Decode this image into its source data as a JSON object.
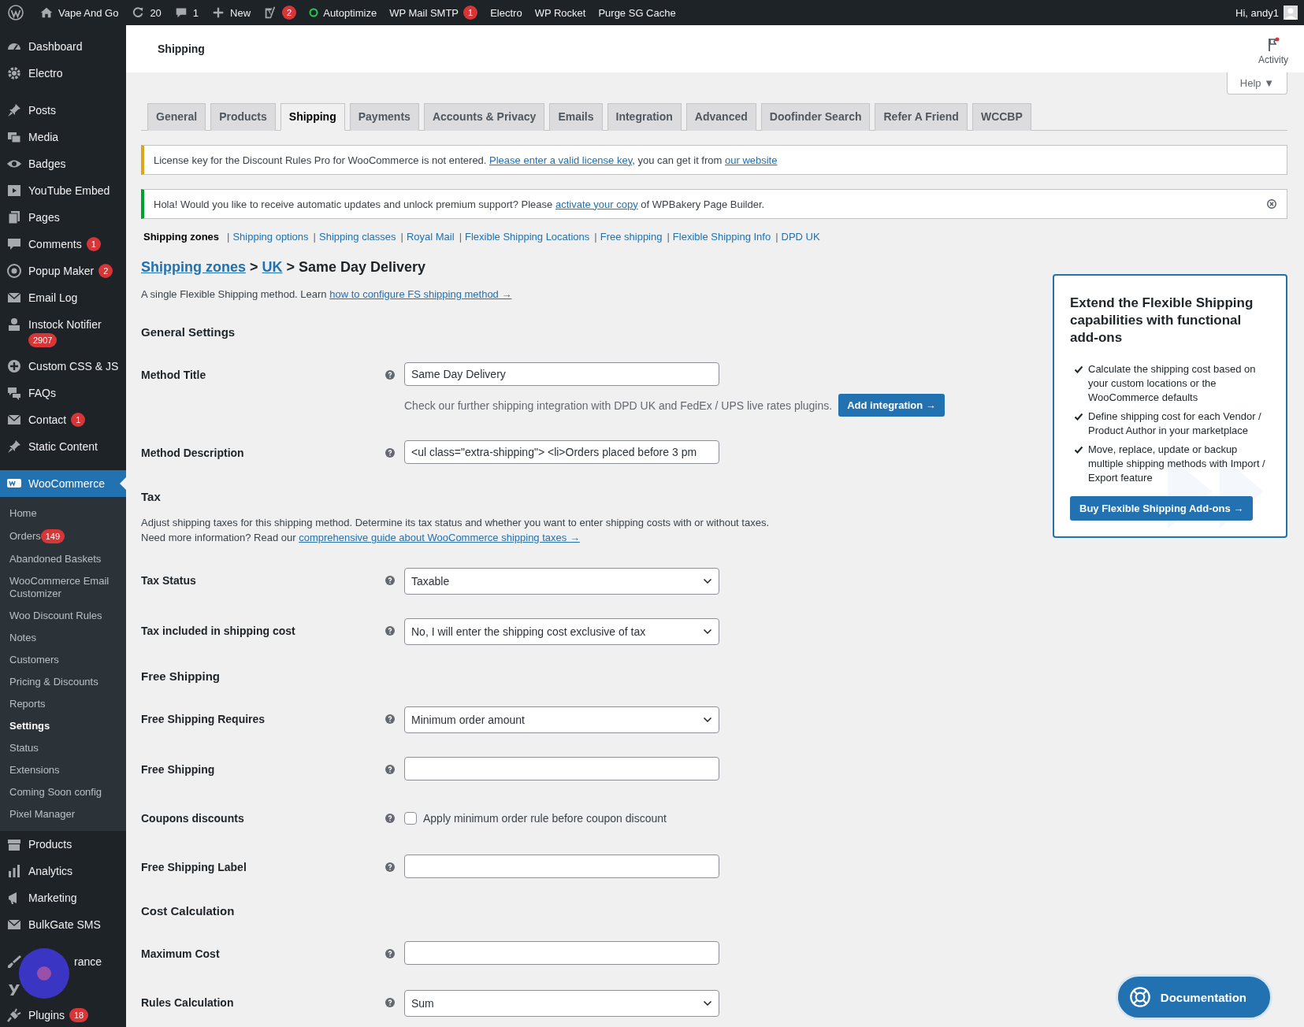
{
  "admin_bar": {
    "items": [
      {
        "label": "Vape And Go"
      },
      {
        "label": "20"
      },
      {
        "label": "1"
      },
      {
        "label": "New"
      },
      {
        "badge": "2"
      },
      {
        "label": "Autoptimize"
      },
      {
        "label": "WP Mail SMTP",
        "badge": "1"
      },
      {
        "label": "Electro"
      },
      {
        "label": "WP Rocket"
      },
      {
        "label": "Purge SG Cache"
      }
    ],
    "greeting": "Hi, andy1"
  },
  "sidebar": {
    "groups": [
      [
        {
          "label": "Dashboard",
          "selected": false
        },
        {
          "label": "Electro",
          "selected": false
        }
      ],
      [
        {
          "label": "Posts",
          "selected": false
        },
        {
          "label": "Media",
          "selected": false
        },
        {
          "label": "Badges",
          "selected": false
        },
        {
          "label": "YouTube Embed",
          "selected": false
        },
        {
          "label": "Pages",
          "selected": false
        },
        {
          "label": "Comments",
          "badge": "1",
          "selected": false
        },
        {
          "label": "Popup Maker",
          "badge": "2",
          "selected": false
        },
        {
          "label": "Email Log",
          "selected": false
        },
        {
          "label": "Instock Notifier",
          "badge": "2907",
          "selected": false
        },
        {
          "label": "Custom CSS & JS",
          "selected": false
        },
        {
          "label": "FAQs",
          "selected": false
        },
        {
          "label": "Contact",
          "badge": "1",
          "selected": false
        },
        {
          "label": "Static Content",
          "selected": false
        }
      ],
      [
        {
          "label": "WooCommerce",
          "selected": true,
          "children": [
            {
              "label": "Home",
              "selected": false
            },
            {
              "label": "Orders",
              "badge": "149",
              "selected": false
            },
            {
              "label": "Abandoned Baskets",
              "selected": false
            },
            {
              "label": "WooCommerce Email Customizer",
              "selected": false
            },
            {
              "label": "Woo Discount Rules",
              "selected": false
            },
            {
              "label": "Notes",
              "selected": false
            },
            {
              "label": "Customers",
              "selected": false
            },
            {
              "label": "Pricing & Discounts",
              "selected": false
            },
            {
              "label": "Reports",
              "selected": false
            },
            {
              "label": "Settings",
              "selected": true
            },
            {
              "label": "Status",
              "selected": false
            },
            {
              "label": "Extensions",
              "selected": false
            },
            {
              "label": "Coming Soon config",
              "selected": false
            },
            {
              "label": "Pixel Manager",
              "selected": false
            }
          ]
        },
        {
          "label": "Products",
          "selected": false
        },
        {
          "label": "Analytics",
          "selected": false
        },
        {
          "label": "Marketing",
          "selected": false
        },
        {
          "label": "BulkGate SMS",
          "selected": false
        }
      ],
      [
        {
          "label": "rance",
          "selected": false,
          "covered": true
        },
        {
          "selected": false
        },
        {
          "label": "Plugins",
          "badge": "18",
          "selected": false
        }
      ]
    ]
  },
  "header": {
    "title": "Shipping",
    "activity": "Activity",
    "help": "Help ▼"
  },
  "tabs": [
    {
      "label": "General",
      "selected": false
    },
    {
      "label": "Products",
      "selected": false
    },
    {
      "label": "Shipping",
      "selected": true
    },
    {
      "label": "Payments",
      "selected": false
    },
    {
      "label": "Accounts & Privacy",
      "selected": false
    },
    {
      "label": "Emails",
      "selected": false
    },
    {
      "label": "Integration",
      "selected": false
    },
    {
      "label": "Advanced",
      "selected": false
    },
    {
      "label": "Doofinder Search",
      "selected": false
    },
    {
      "label": "Refer A Friend",
      "selected": false
    },
    {
      "label": "WCCBP",
      "selected": false
    }
  ],
  "notices": [
    {
      "kind": "warning",
      "dismissible": false,
      "parts": [
        {
          "text": "License key for the Discount Rules Pro for WooCommerce is not entered. "
        },
        {
          "link": "Please enter a valid license key"
        },
        {
          "text": ", you can get it from "
        },
        {
          "link": "our website"
        }
      ]
    },
    {
      "kind": "success",
      "dismissible": true,
      "parts": [
        {
          "text": "Hola! Would you like to receive automatic updates and unlock premium support? Please "
        },
        {
          "link": "activate your copy"
        },
        {
          "text": " of WPBakery Page Builder."
        }
      ]
    }
  ],
  "sections": [
    {
      "label": "Shipping zones",
      "selected": true
    },
    {
      "label": "Shipping options",
      "prefix": "|",
      "selected": false
    },
    {
      "label": "Shipping classes",
      "prefix": "|",
      "selected": false
    },
    {
      "label": "Royal Mail",
      "prefix": "|",
      "selected": false
    },
    {
      "label": "Flexible Shipping Locations",
      "prefix": "|",
      "selected": false
    },
    {
      "label": "Free shipping",
      "prefix": "|",
      "selected": false
    },
    {
      "label": "Flexible Shipping Info",
      "prefix": "|",
      "selected": false
    },
    {
      "label": "DPD UK",
      "prefix": "|",
      "selected": false
    }
  ],
  "breadcrumb": [
    {
      "link": "Shipping zones"
    },
    {
      "text": " > "
    },
    {
      "link": "UK"
    },
    {
      "text": " > Same Day Delivery"
    }
  ],
  "form": [
    {
      "kind": "paragraph",
      "parts": [
        {
          "text": "A single Flexible Shipping method. Learn "
        },
        {
          "link": "how to configure FS shipping method →"
        }
      ]
    },
    {
      "kind": "heading",
      "label": "General Settings"
    },
    {
      "kind": "text",
      "label": "Method Title",
      "value": "Same Day Delivery",
      "note": "Check our further shipping integration with DPD UK and FedEx / UPS live rates plugins.",
      "note_button": "Add integration →"
    },
    {
      "kind": "text",
      "label": "Method Description",
      "value": "<ul class=\"extra-shipping\"> <li>Orders placed before 3 pm"
    },
    {
      "kind": "heading",
      "label": "Tax"
    },
    {
      "kind": "paragraph",
      "parts": [
        {
          "text": "Adjust shipping taxes for this shipping method. Determine its tax status and whether you want to enter shipping costs with or without taxes."
        }
      ]
    },
    {
      "kind": "paragraph",
      "parts": [
        {
          "text": "Need more information? Read our "
        },
        {
          "link": "comprehensive guide about WooCommerce shipping taxes →"
        }
      ]
    },
    {
      "kind": "select",
      "label": "Tax Status",
      "value": "Taxable"
    },
    {
      "kind": "select",
      "label": "Tax included in shipping cost",
      "value": "No, I will enter the shipping cost exclusive of tax"
    },
    {
      "kind": "heading",
      "label": "Free Shipping"
    },
    {
      "kind": "select",
      "label": "Free Shipping Requires",
      "value": "Minimum order amount"
    },
    {
      "kind": "text",
      "label": "Free Shipping"
    },
    {
      "kind": "checkbox",
      "label": "Coupons discounts",
      "option": "Apply minimum order rule before coupon discount",
      "checked": false
    },
    {
      "kind": "text",
      "label": "Free Shipping Label"
    },
    {
      "kind": "heading",
      "label": "Cost Calculation"
    },
    {
      "kind": "text",
      "label": "Maximum Cost"
    },
    {
      "kind": "select",
      "label": "Rules Calculation",
      "value": "Sum"
    }
  ],
  "promo": {
    "title": "Extend the Flexible Shipping capabilities with functional add-ons",
    "features": [
      "Calculate the shipping cost based on your custom locations or the WooCommerce defaults",
      "Define shipping cost for each Vendor / Product Author in your marketplace",
      "Move, replace, update or backup multiple shipping methods with Import / Export feature"
    ],
    "button": "Buy Flexible Shipping Add-ons →"
  },
  "documentation_button": "Documentation"
}
